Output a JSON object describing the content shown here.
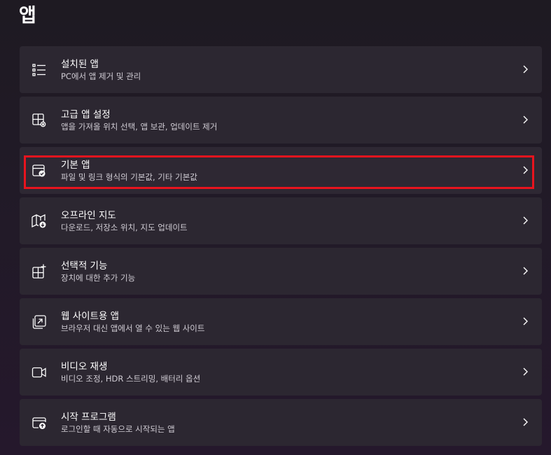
{
  "page": {
    "title": "앱"
  },
  "items": [
    {
      "title": "설치된 앱",
      "subtitle": "PC에서 앱 제거 및 관리",
      "icon": "list-icon"
    },
    {
      "title": "고급 앱 설정",
      "subtitle": "앱을 가져올 위치 선택, 앱 보관, 업데이트 제거",
      "icon": "app-settings-icon"
    },
    {
      "title": "기본 앱",
      "subtitle": "파일 및 링크 형식의 기본값, 기타 기본값",
      "icon": "default-apps-icon"
    },
    {
      "title": "오프라인 지도",
      "subtitle": "다운로드, 저장소 위치, 지도 업데이트",
      "icon": "map-download-icon"
    },
    {
      "title": "선택적 기능",
      "subtitle": "장치에 대한 추가 기능",
      "icon": "add-apps-icon"
    },
    {
      "title": "웹 사이트용 앱",
      "subtitle": "브라우저 대신 앱에서 열 수 있는 웹 사이트",
      "icon": "open-in-app-icon"
    },
    {
      "title": "비디오 재생",
      "subtitle": "비디오 조정, HDR 스트리밍, 배터리 옵션",
      "icon": "video-icon"
    },
    {
      "title": "시작 프로그램",
      "subtitle": "로그인할 때 자동으로 시작되는 앱",
      "icon": "startup-icon"
    }
  ],
  "highlight": {
    "item_index": 2,
    "color": "#e8141e"
  },
  "colors": {
    "card_background": "#2c2731",
    "text_primary": "#ffffff",
    "text_secondary": "#d0ccd4"
  }
}
